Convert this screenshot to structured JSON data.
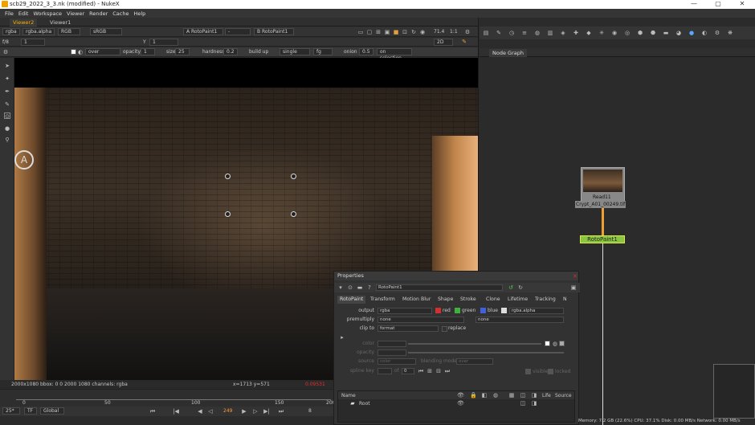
{
  "window": {
    "title": "scb29_2022_3_3.nk (modified) - NukeX",
    "controls": [
      "—",
      "▢",
      "✕"
    ]
  },
  "menu": [
    "File",
    "Edit",
    "Workspace",
    "Viewer",
    "Render",
    "Cache",
    "Help"
  ],
  "viewer_tabs": [
    "Viewer2",
    "Viewer1"
  ],
  "viewer_toolbar": {
    "channels": "rgba",
    "layer": "rgba.alpha",
    "display": "RGB",
    "lut": "sRGB",
    "input_a": "A RotoPaint1",
    "input_a_op": "-",
    "input_b": "B RotoPaint1",
    "zoom": "71.4",
    "proxy": "1:1",
    "view_mode": "2D",
    "frame_f": "f/8",
    "frame_val": "1",
    "y_label": "Y",
    "y_val": "1"
  },
  "paint_toolbar": {
    "mode": "over",
    "opacity_label": "opacity",
    "opacity": "1",
    "size_label": "size",
    "size": "25",
    "hardness_label": "hardness",
    "hardness": "0.2",
    "buildup_label": "build up",
    "stroke_type": "single",
    "source": "fg",
    "onion_label": "onion",
    "onion": "0.5",
    "on_selection": "on selection"
  },
  "viewer_info": {
    "format": "2000x1080  bbox: 0 0 2000 1080 channels: rgba",
    "coords": "x=1713 y=571",
    "value": "0.09531  0.06033"
  },
  "timeline": {
    "ticks": [
      "0",
      "50",
      "100",
      "150",
      "200"
    ],
    "current": "249",
    "fps_label": "25*",
    "tf": "TF",
    "global": "Global",
    "step": "8",
    "frame_start": "1"
  },
  "node_graph": {
    "tab": "Node Graph",
    "read_name": "Read11",
    "read_file": "Crypt_A01_00249.tif",
    "roto_name": "RotoPaint1"
  },
  "properties": {
    "title": "Properties",
    "node_name": "RotoPaint1",
    "tabs": [
      "RotoPaint",
      "Transform",
      "Motion Blur",
      "Shape",
      "Stroke",
      "Clone",
      "Lifetime",
      "Tracking",
      "N"
    ],
    "output_label": "output",
    "output": "rgba",
    "red": "red",
    "green": "green",
    "blue": "blue",
    "alpha": "rgba.alpha",
    "premultiply_label": "premultiply",
    "premultiply": "none",
    "premultiply2": "none",
    "clipto_label": "clip to",
    "clipto": "format",
    "replace": "replace",
    "color_label": "color",
    "opacity_label": "opacity",
    "source_label": "source",
    "source": "color",
    "blending_label": "blending mode",
    "blending": "over",
    "splinekey_label": "spline key",
    "splinekey_of": "of",
    "splinekey_val": "0",
    "visible": "visible",
    "locked": "locked",
    "cols": [
      "Name",
      "Life",
      "Source"
    ],
    "root": "Root"
  },
  "status": "Memory: 7.2 GB (22.6%)  CPU: 37.1%  Disk: 0.00 MB/s  Network: 0.00 MB/s"
}
